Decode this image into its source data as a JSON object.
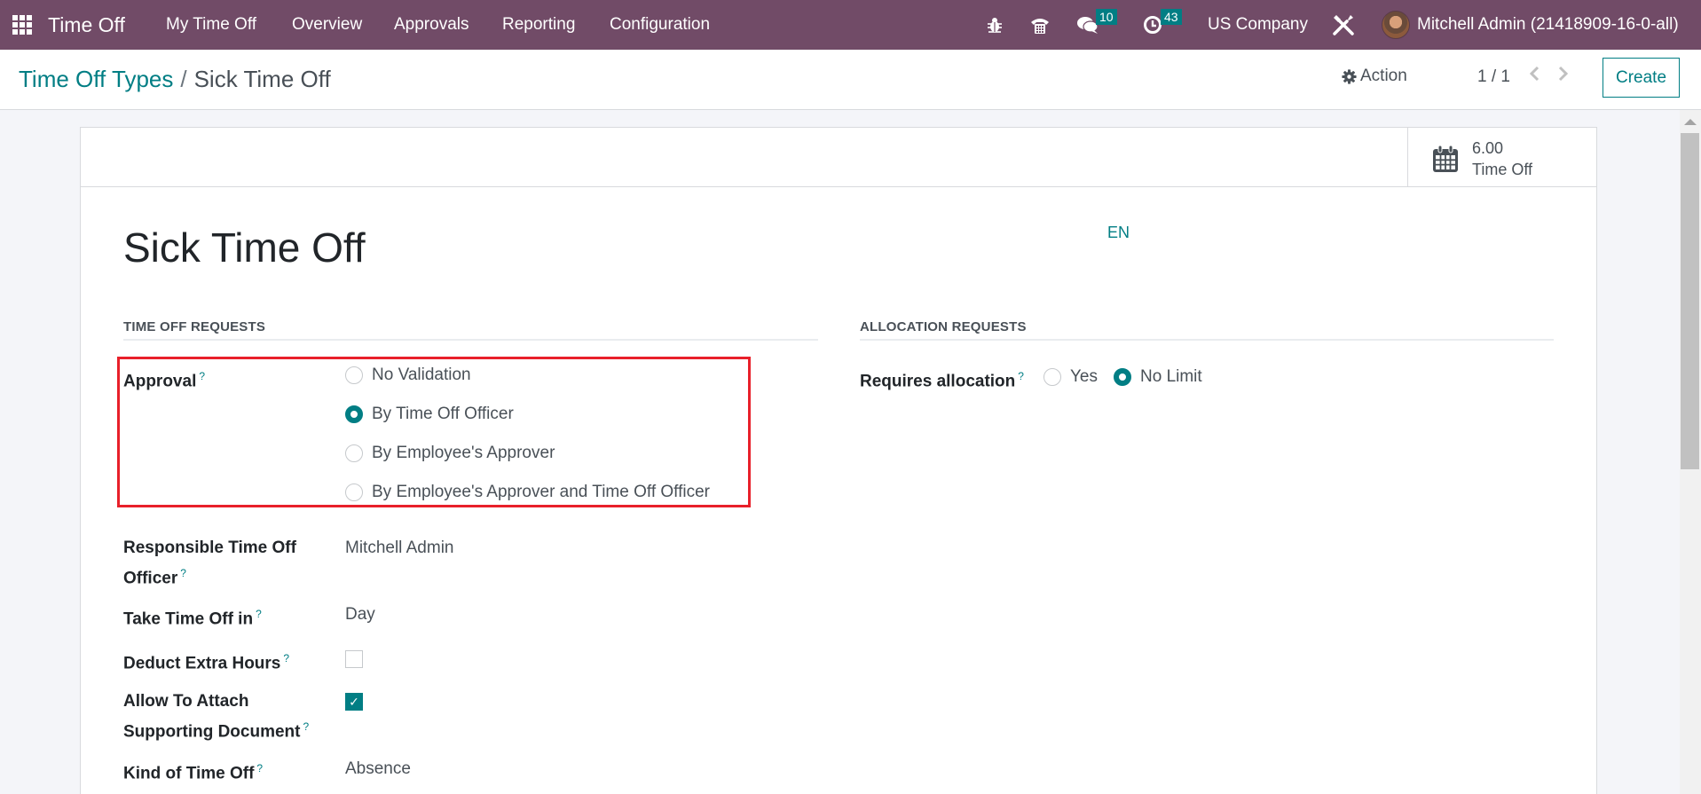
{
  "navbar": {
    "app_name": "Time Off",
    "menu": [
      {
        "label": "My Time Off"
      },
      {
        "label": "Overview"
      },
      {
        "label": "Approvals"
      },
      {
        "label": "Reporting"
      },
      {
        "label": "Configuration"
      }
    ],
    "icons": {
      "apps": "apps-grid-icon",
      "debug": "bug-icon",
      "voip": "phone-icon",
      "messages": "chat-icon",
      "activities": "clock-icon",
      "settings": "tools-icon"
    },
    "messages_count": "10",
    "activities_count": "43",
    "company": "US Company",
    "user": "Mitchell Admin (21418909-16-0-all)"
  },
  "control_panel": {
    "breadcrumb_parent": "Time Off Types",
    "breadcrumb_separator": "/",
    "breadcrumb_current": "Sick Time Off",
    "action_label": "Action",
    "pager": "1 / 1",
    "create_label": "Create"
  },
  "stat_button": {
    "value": "6.00",
    "label": "Time Off"
  },
  "record": {
    "title": "Sick Time Off",
    "lang": "EN"
  },
  "time_off_requests": {
    "header": "TIME OFF REQUESTS",
    "approval": {
      "label": "Approval",
      "help": "?",
      "options": [
        {
          "label": "No Validation",
          "checked": false
        },
        {
          "label": "By Time Off Officer",
          "checked": true
        },
        {
          "label": "By Employee's Approver",
          "checked": false
        },
        {
          "label": "By Employee's Approver and Time Off Officer",
          "checked": false
        }
      ]
    },
    "responsible": {
      "label_line1": "Responsible Time Off",
      "label_line2": "Officer",
      "help": "?",
      "value": "Mitchell Admin"
    },
    "take_time_off_in": {
      "label": "Take Time Off in",
      "help": "?",
      "value": "Day"
    },
    "deduct_extra_hours": {
      "label": "Deduct Extra Hours",
      "help": "?",
      "checked": false
    },
    "allow_attach": {
      "label_line1": "Allow To Attach",
      "label_line2": "Supporting Document",
      "help": "?",
      "checked": true,
      "check_glyph": "✓"
    },
    "kind_of_time_off": {
      "label": "Kind of Time Off",
      "help": "?",
      "value": "Absence"
    }
  },
  "allocation_requests": {
    "header": "ALLOCATION REQUESTS",
    "requires_allocation": {
      "label": "Requires allocation",
      "help": "?",
      "options": [
        {
          "label": "Yes",
          "checked": false
        },
        {
          "label": "No Limit",
          "checked": true
        }
      ]
    }
  },
  "colors": {
    "navbar": "#714B67",
    "accent": "#017e84",
    "highlight": "#e8202a"
  }
}
